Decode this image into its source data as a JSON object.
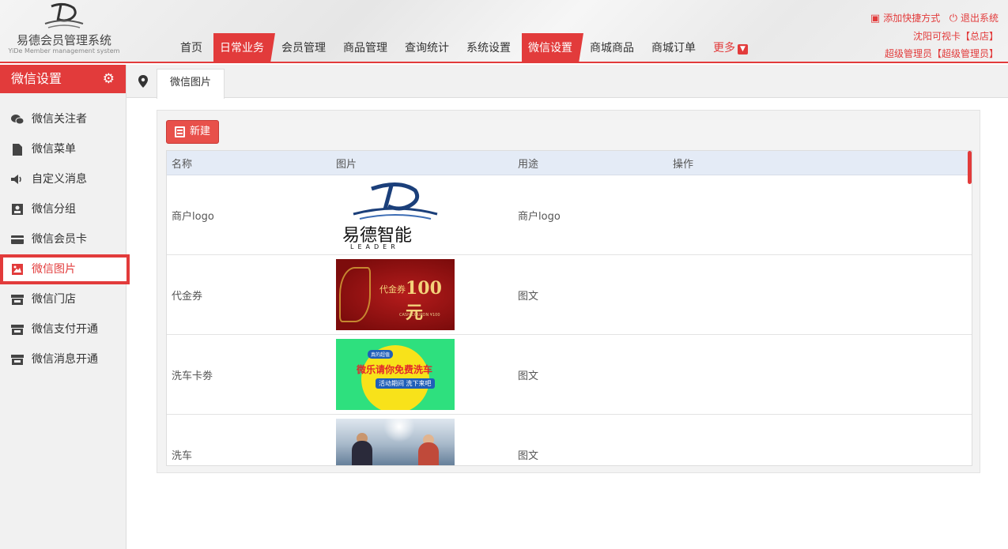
{
  "logo": {
    "title": "易德会员管理系统",
    "subtitle": "YiDe Member management system"
  },
  "nav": {
    "items": [
      {
        "label": "首页",
        "active": false
      },
      {
        "label": "日常业务",
        "active": true
      },
      {
        "label": "会员管理",
        "active": false
      },
      {
        "label": "商品管理",
        "active": false
      },
      {
        "label": "查询统计",
        "active": false
      },
      {
        "label": "系统设置",
        "active": false
      },
      {
        "label": "微信设置",
        "active": true
      },
      {
        "label": "商城商品",
        "active": false
      },
      {
        "label": "商城订单",
        "active": false
      }
    ],
    "more_label": "更多"
  },
  "top_right": {
    "add_shortcut": "添加快捷方式",
    "logout": "退出系统",
    "store": "沈阳可视卡【总店】",
    "user": "超级管理员【超级管理员】"
  },
  "sidebar": {
    "title": "微信设置",
    "items": [
      {
        "label": "微信关注者",
        "icon": "wechat-icon"
      },
      {
        "label": "微信菜单",
        "icon": "document-icon"
      },
      {
        "label": "自定义消息",
        "icon": "speaker-icon"
      },
      {
        "label": "微信分组",
        "icon": "contact-card-icon"
      },
      {
        "label": "微信会员卡",
        "icon": "credit-card-icon"
      },
      {
        "label": "微信图片",
        "icon": "image-icon",
        "active": true
      },
      {
        "label": "微信门店",
        "icon": "store-icon"
      },
      {
        "label": "微信支付开通",
        "icon": "store-icon"
      },
      {
        "label": "微信消息开通",
        "icon": "store-icon"
      }
    ]
  },
  "tabbar": {
    "active_tab": "微信图片"
  },
  "toolbar": {
    "new_label": "新建"
  },
  "table": {
    "headers": [
      "名称",
      "图片",
      "用途",
      "操作"
    ],
    "rows": [
      {
        "name": "商户logo",
        "usage": "商户logo",
        "image": "logo",
        "image_text": "易德智能",
        "image_subtext": "LEADER"
      },
      {
        "name": "代金券",
        "usage": "图文",
        "image": "coupon",
        "image_text": "代金券",
        "image_amount": "100元",
        "image_subtext": "CASH COUPON ¥100"
      },
      {
        "name": "洗车卡劵",
        "usage": "图文",
        "image": "wash",
        "image_tag": "真的超值",
        "image_text": "微乐请你免费洗车",
        "image_button": "活动期间 洗下来吧"
      },
      {
        "name": "洗车",
        "usage": "图文",
        "image": "photo"
      }
    ]
  },
  "colors": {
    "accent": "#e23b3b",
    "table_header": "#e4ebf6",
    "sidebar_bg": "#f1f1f1"
  }
}
